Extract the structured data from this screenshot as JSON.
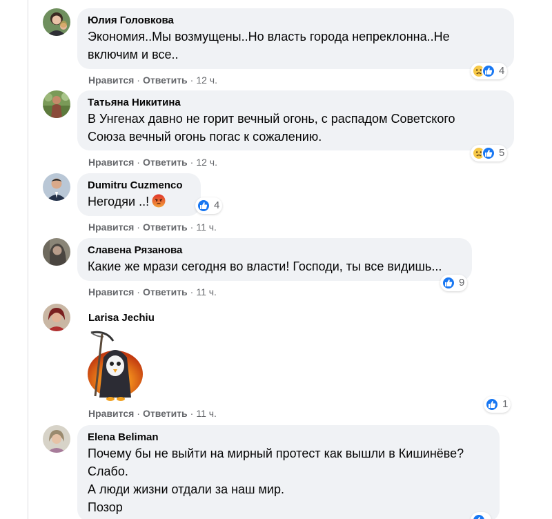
{
  "comments": [
    {
      "author": "Юлия Головкова",
      "text": "Экономия..Мы возмущены..Но власть города непреклонна..Не\nвключим и все..",
      "like_label": "Нравится",
      "reply_label": "Ответить",
      "time": "12 ч.",
      "reaction_count": "4",
      "reaction_icons": [
        "sad-reaction-icon",
        "like-reaction-icon"
      ]
    },
    {
      "author": "Татьяна Никитина",
      "text": "В Унгенах давно не горит вечный огонь, с распадом Советского\nСоюза вечный огонь погас к сожалению.",
      "like_label": "Нравится",
      "reply_label": "Ответить",
      "time": "12 ч.",
      "reaction_count": "5",
      "reaction_icons": [
        "sad-reaction-icon",
        "like-reaction-icon"
      ]
    },
    {
      "author": "Dumitru Cuzmenco",
      "text": "Негодяи ..!",
      "like_label": "Нравится",
      "reply_label": "Ответить",
      "time": "11 ч.",
      "reaction_count": "4",
      "reaction_icons": [
        "like-reaction-icon"
      ]
    },
    {
      "author": "Славена Рязанова",
      "text": "Какие же мрази сегодня во власти! Господи, ты все видишь...",
      "like_label": "Нравится",
      "reply_label": "Ответить",
      "time": "11 ч.",
      "reaction_count": "9",
      "reaction_icons": [
        "like-reaction-icon"
      ]
    },
    {
      "author": "Larisa Jechiu",
      "text": "",
      "sticker": "grim-reaper-sticker",
      "like_label": "Нравится",
      "reply_label": "Ответить",
      "time": "11 ч.",
      "reaction_count": "1",
      "reaction_icons": [
        "like-reaction-icon"
      ]
    },
    {
      "author": "Elena Beliman",
      "text": "Почему бы не выйти на мирный протест как вышли в Кишинёве?\nСлабо.\nА люди жизни отдали за наш мир.\nПозор",
      "reaction_icons": [
        "like-reaction-icon"
      ]
    }
  ],
  "separator": "·",
  "colors": {
    "bubble": "#f0f2f5",
    "like_blue": "#1877f2",
    "meta_gray": "#65676b",
    "sad_yellow": "#f7c948",
    "angry_red": "#e9710f"
  }
}
